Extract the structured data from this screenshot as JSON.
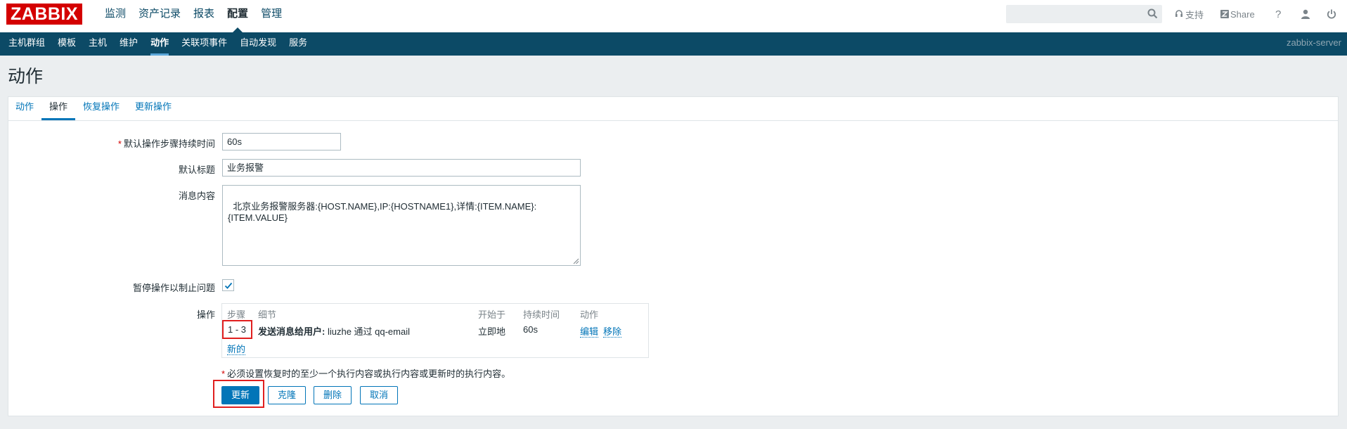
{
  "app": {
    "logo_text": "ZABBIX",
    "server_name": "zabbix-server"
  },
  "top_menu": [
    {
      "label": "监测"
    },
    {
      "label": "资产记录"
    },
    {
      "label": "报表"
    },
    {
      "label": "配置",
      "active": true
    },
    {
      "label": "管理"
    }
  ],
  "header_tools": {
    "search_placeholder": "",
    "support_label": "支持",
    "share_label": "Share",
    "help_label": "?"
  },
  "sub_menu": [
    {
      "label": "主机群组"
    },
    {
      "label": "模板"
    },
    {
      "label": "主机"
    },
    {
      "label": "维护"
    },
    {
      "label": "动作",
      "active": true
    },
    {
      "label": "关联项事件"
    },
    {
      "label": "自动发现"
    },
    {
      "label": "服务"
    }
  ],
  "page_title": "动作",
  "tabs": [
    {
      "label": "动作"
    },
    {
      "label": "操作",
      "active": true
    },
    {
      "label": "恢复操作"
    },
    {
      "label": "更新操作"
    }
  ],
  "form": {
    "step_duration": {
      "label": "默认操作步骤持续时间",
      "required_mark": "*",
      "value": "60s"
    },
    "subject": {
      "label": "默认标题",
      "value": "业务报警"
    },
    "message": {
      "label": "消息内容",
      "value": "北京业务报警服务器:{HOST.NAME},IP:{HOSTNAME1},详情:{ITEM.NAME}:\n{ITEM.VALUE}"
    },
    "pause": {
      "label": "暂停操作以制止问题",
      "checked": true
    },
    "operations": {
      "label": "操作",
      "columns": [
        "步骤",
        "细节",
        "开始于",
        "持续时间",
        "动作"
      ],
      "rows": [
        {
          "steps": "1 - 3",
          "detail_bold": "发送消息给用户:",
          "detail_text": " liuzhe 通过 qq-email",
          "start": "立即地",
          "duration": "60s",
          "edit_label": "编辑",
          "remove_label": "移除"
        }
      ],
      "new_label": "新的"
    },
    "note": {
      "required_mark": "*",
      "text": "必须设置恢复时的至少一个执行内容或执行内容或更新时的执行内容。"
    }
  },
  "buttons": {
    "update": "更新",
    "clone": "克隆",
    "delete": "删除",
    "cancel": "取消"
  },
  "colors": {
    "brand": "#d40000",
    "nav_bg": "#0c4a66",
    "accent": "#0275b8",
    "highlight_box": "#e01f1f"
  }
}
